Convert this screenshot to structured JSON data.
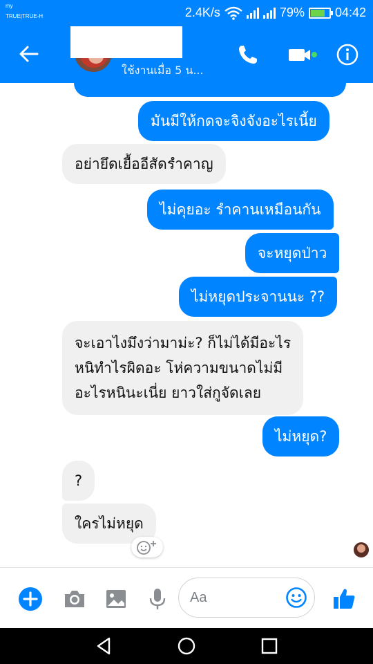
{
  "status_bar": {
    "carrier_top": "my",
    "carrier_bottom": "TRUE|TRUE-H",
    "speed": "2.4K/s",
    "battery_percent": "79%",
    "battery_level": 0.79,
    "time": "04:42"
  },
  "header": {
    "last_active": "ใช้งานเมื่อ 5 น..."
  },
  "messages": [
    {
      "side": "out",
      "text": "มันมีให้กดจะจิงจังอะไรเนี้ย"
    },
    {
      "side": "in",
      "text": "อย่ายึดเยื้ออีสัดรำคาญ"
    },
    {
      "side": "out",
      "text": "ไม่คุยอะ รำคานเหมือนกัน"
    },
    {
      "side": "out",
      "text": "จะหยุดป่าว"
    },
    {
      "side": "out",
      "text": "ไม่หยุดประจานนะ ??"
    },
    {
      "side": "in",
      "lines": [
        "จะเอาไงมึงว่ามาม่ะ? ก็ไม่ได้มีอะไร",
        "หนิทำไรผิดอะ โห่ความขนาดไม่มี",
        "อะไรหนินะเนี่ย ยาวใส่กูจัดเลย"
      ]
    },
    {
      "side": "out",
      "text": "ไม่หยุด?"
    },
    {
      "side": "in",
      "text": "?"
    },
    {
      "side": "in",
      "text": "ใครไม่หยุด"
    }
  ],
  "composer": {
    "placeholder": "Aa"
  },
  "colors": {
    "accent": "#0084ff",
    "incoming_bubble": "#f1f0f0"
  },
  "icons": [
    "back-arrow-icon",
    "phone-icon",
    "video-camera-icon",
    "info-icon",
    "add-icon",
    "camera-icon",
    "image-icon",
    "microphone-icon",
    "emoji-icon",
    "thumbs-up-icon",
    "add-reaction-icon",
    "nav-back-icon",
    "nav-home-icon",
    "nav-recents-icon"
  ]
}
